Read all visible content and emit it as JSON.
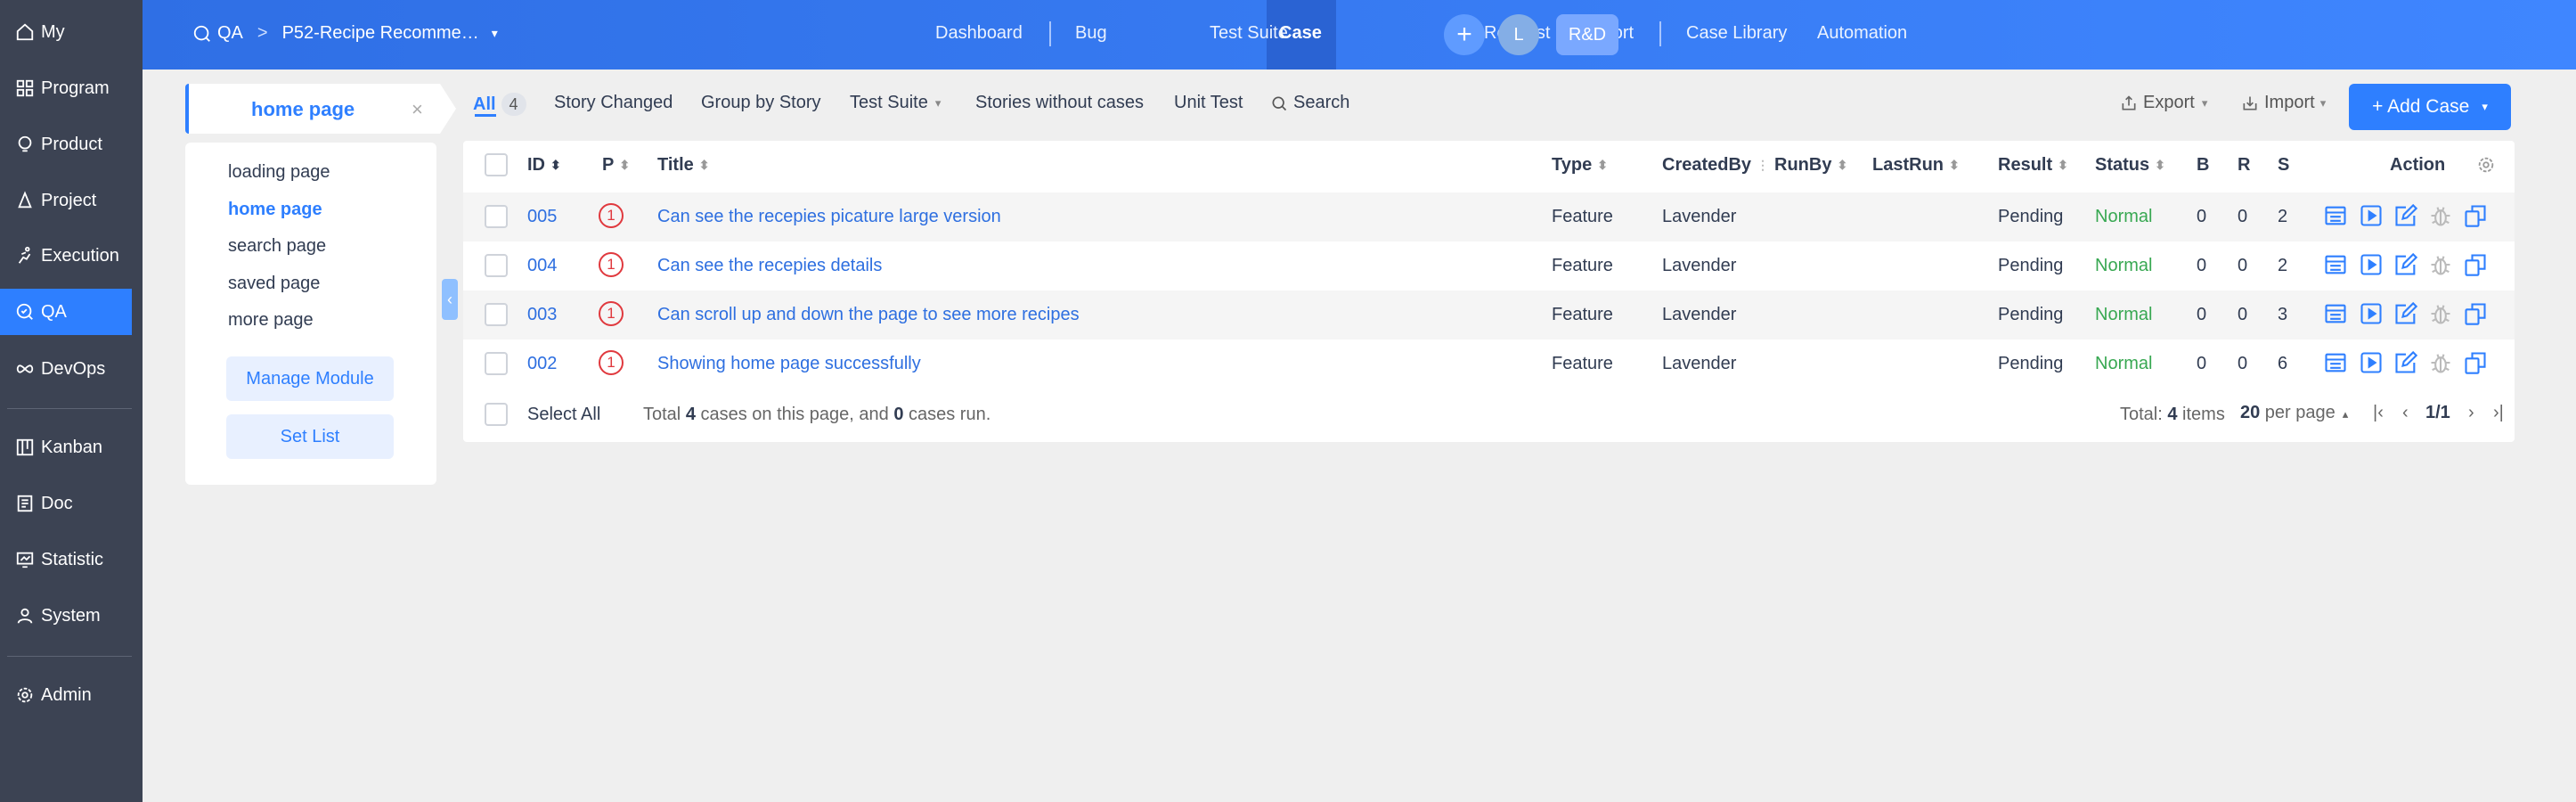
{
  "sidebar": {
    "items": [
      {
        "label": "My",
        "icon": "home-icon"
      },
      {
        "label": "Program",
        "icon": "grid-icon"
      },
      {
        "label": "Product",
        "icon": "product-icon"
      },
      {
        "label": "Project",
        "icon": "project-icon"
      },
      {
        "label": "Execution",
        "icon": "run-icon"
      },
      {
        "label": "QA",
        "icon": "qa-icon"
      },
      {
        "label": "DevOps",
        "icon": "infinity-icon"
      },
      {
        "label": "Kanban",
        "icon": "kanban-icon"
      },
      {
        "label": "Doc",
        "icon": "doc-icon"
      },
      {
        "label": "Statistic",
        "icon": "statistic-icon"
      },
      {
        "label": "System",
        "icon": "user-icon"
      },
      {
        "label": "Admin",
        "icon": "gear-icon"
      }
    ],
    "active": "QA"
  },
  "topbar": {
    "qa_label": "QA",
    "breadcrumb_sep": ">",
    "project": "P52-Recipe Recomme…",
    "nav": [
      "Dashboard",
      "Bug",
      "Case",
      "Test Suite",
      "Request",
      "Report",
      "Case Library",
      "Automation"
    ],
    "active_nav": "Case",
    "avatar_letter": "L",
    "rd_label": "R&D",
    "plus_label": "+"
  },
  "module_tab": {
    "label": "home page",
    "close": "×"
  },
  "modules": {
    "items": [
      "loading page",
      "home page",
      "search page",
      "saved page",
      "more page"
    ],
    "active": "home page",
    "manage_label": "Manage Module",
    "setlist_label": "Set List",
    "collapse_glyph": "‹"
  },
  "filters": {
    "all_label": "All",
    "all_count": "4",
    "items": [
      "Story Changed",
      "Group by Story",
      "Test Suite",
      "Stories without cases",
      "Unit Test",
      "Search"
    ],
    "export_label": "Export",
    "import_label": "Import",
    "add_case_label": "+ Add Case"
  },
  "table": {
    "headers": {
      "id": "ID",
      "p": "P",
      "title": "Title",
      "type": "Type",
      "createdby": "CreatedBy",
      "runby": "RunBy",
      "lastrun": "LastRun",
      "result": "Result",
      "status": "Status",
      "b": "B",
      "r": "R",
      "s": "S",
      "action": "Action"
    },
    "rows": [
      {
        "id": "005",
        "p": "1",
        "title": "Can see the recepies picature large version",
        "type": "Feature",
        "createdby": "Lavender",
        "result": "Pending",
        "status": "Normal",
        "b": "0",
        "r": "0",
        "s": "2"
      },
      {
        "id": "004",
        "p": "1",
        "title": "Can see the recepies details",
        "type": "Feature",
        "createdby": "Lavender",
        "result": "Pending",
        "status": "Normal",
        "b": "0",
        "r": "0",
        "s": "2"
      },
      {
        "id": "003",
        "p": "1",
        "title": "Can scroll up and down the page to see more recipes",
        "type": "Feature",
        "createdby": "Lavender",
        "result": "Pending",
        "status": "Normal",
        "b": "0",
        "r": "0",
        "s": "3"
      },
      {
        "id": "002",
        "p": "1",
        "title": "Showing home page successfully",
        "type": "Feature",
        "createdby": "Lavender",
        "result": "Pending",
        "status": "Normal",
        "b": "0",
        "r": "0",
        "s": "6"
      }
    ],
    "footer": {
      "select_all": "Select All",
      "summary_pre": "Total ",
      "summary_count": "4",
      "summary_mid": " cases on this page, and ",
      "summary_run": "0",
      "summary_post": " cases run.",
      "total_pre": "Total: ",
      "total_count": "4",
      "total_post": " items",
      "per_page": "20",
      "per_page_label": " per page",
      "page": "1/1"
    }
  },
  "colors": {
    "accent": "#2e7fff",
    "sidebar": "#3c4353",
    "priority": "#e0393e",
    "status_normal": "#38a852"
  }
}
